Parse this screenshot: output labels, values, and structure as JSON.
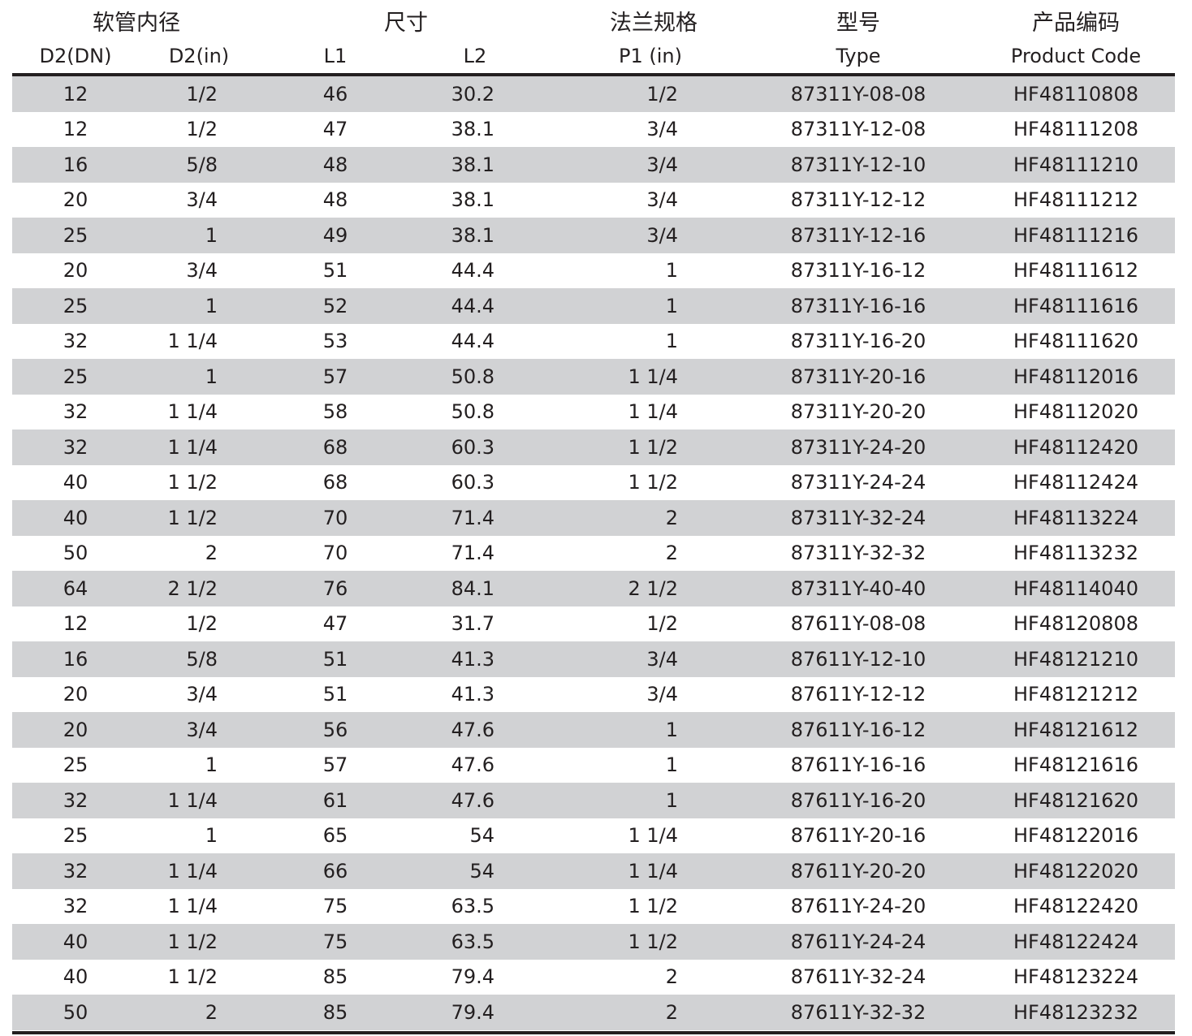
{
  "groups": [
    "软管内径",
    "尺寸",
    "法兰规格",
    "型号",
    "产品编码"
  ],
  "columns": [
    "D2(DN)",
    "D2(in)",
    "L1",
    "L2",
    "P1 (in)",
    "Type",
    "Product Code"
  ],
  "rows": [
    [
      "12",
      "1/2",
      "46",
      "30.2",
      "1/2",
      "87311Y-08-08",
      "HF48110808"
    ],
    [
      "12",
      "1/2",
      "47",
      "38.1",
      "3/4",
      "87311Y-12-08",
      "HF48111208"
    ],
    [
      "16",
      "5/8",
      "48",
      "38.1",
      "3/4",
      "87311Y-12-10",
      "HF48111210"
    ],
    [
      "20",
      "3/4",
      "48",
      "38.1",
      "3/4",
      "87311Y-12-12",
      "HF48111212"
    ],
    [
      "25",
      "1",
      "49",
      "38.1",
      "3/4",
      "87311Y-12-16",
      "HF48111216"
    ],
    [
      "20",
      "3/4",
      "51",
      "44.4",
      "1",
      "87311Y-16-12",
      "HF48111612"
    ],
    [
      "25",
      "1",
      "52",
      "44.4",
      "1",
      "87311Y-16-16",
      "HF48111616"
    ],
    [
      "32",
      "1 1/4",
      "53",
      "44.4",
      "1",
      "87311Y-16-20",
      "HF48111620"
    ],
    [
      "25",
      "1",
      "57",
      "50.8",
      "1 1/4",
      "87311Y-20-16",
      "HF48112016"
    ],
    [
      "32",
      "1 1/4",
      "58",
      "50.8",
      "1 1/4",
      "87311Y-20-20",
      "HF48112020"
    ],
    [
      "32",
      "1 1/4",
      "68",
      "60.3",
      "1 1/2",
      "87311Y-24-20",
      "HF48112420"
    ],
    [
      "40",
      "1 1/2",
      "68",
      "60.3",
      "1 1/2",
      "87311Y-24-24",
      "HF48112424"
    ],
    [
      "40",
      "1 1/2",
      "70",
      "71.4",
      "2",
      "87311Y-32-24",
      "HF48113224"
    ],
    [
      "50",
      "2",
      "70",
      "71.4",
      "2",
      "87311Y-32-32",
      "HF48113232"
    ],
    [
      "64",
      "2 1/2",
      "76",
      "84.1",
      "2 1/2",
      "87311Y-40-40",
      "HF48114040"
    ],
    [
      "12",
      "1/2",
      "47",
      "31.7",
      "1/2",
      "87611Y-08-08",
      "HF48120808"
    ],
    [
      "16",
      "5/8",
      "51",
      "41.3",
      "3/4",
      "87611Y-12-10",
      "HF48121210"
    ],
    [
      "20",
      "3/4",
      "51",
      "41.3",
      "3/4",
      "87611Y-12-12",
      "HF48121212"
    ],
    [
      "20",
      "3/4",
      "56",
      "47.6",
      "1",
      "87611Y-16-12",
      "HF48121612"
    ],
    [
      "25",
      "1",
      "57",
      "47.6",
      "1",
      "87611Y-16-16",
      "HF48121616"
    ],
    [
      "32",
      "1 1/4",
      "61",
      "47.6",
      "1",
      "87611Y-16-20",
      "HF48121620"
    ],
    [
      "25",
      "1",
      "65",
      "54",
      "1 1/4",
      "87611Y-20-16",
      "HF48122016"
    ],
    [
      "32",
      "1 1/4",
      "66",
      "54",
      "1 1/4",
      "87611Y-20-20",
      "HF48122020"
    ],
    [
      "32",
      "1 1/4",
      "75",
      "63.5",
      "1 1/2",
      "87611Y-24-20",
      "HF48122420"
    ],
    [
      "40",
      "1 1/2",
      "75",
      "63.5",
      "1 1/2",
      "87611Y-24-24",
      "HF48122424"
    ],
    [
      "40",
      "1 1/2",
      "85",
      "79.4",
      "2",
      "87611Y-32-24",
      "HF48123224"
    ],
    [
      "50",
      "2",
      "85",
      "79.4",
      "2",
      "87611Y-32-32",
      "HF48123232"
    ]
  ]
}
